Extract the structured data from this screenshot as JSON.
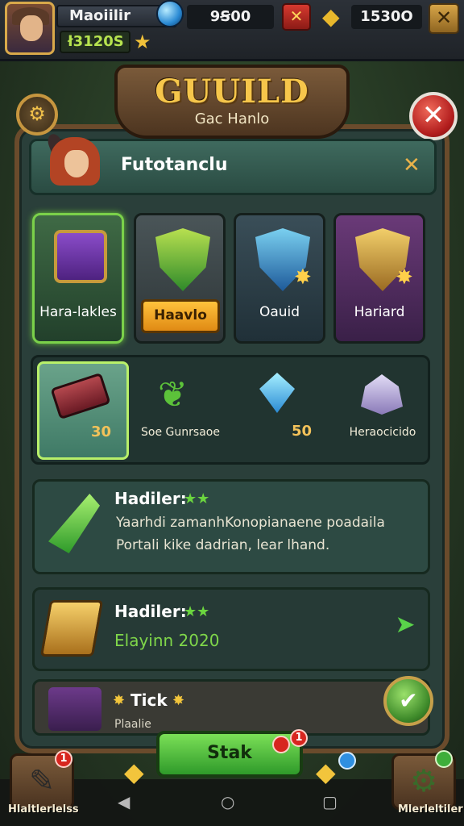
{
  "hud": {
    "player_name": "Maoiilir",
    "gold": "ł3120S",
    "resource_1": "9Ꞩ00",
    "resource_2": "1530O",
    "close_icon": "x-icon"
  },
  "banner": {
    "title": "GUUILD",
    "subtitle": "Gac Hanlo"
  },
  "header": {
    "title": "Futotanclu",
    "close_label": "✕"
  },
  "categories": [
    {
      "label": "Hara-lakles",
      "icon": "purple-chest-icon",
      "selected": true
    },
    {
      "label": "Haavlo",
      "icon": "green-shield-icon",
      "button": true
    },
    {
      "label": "Oauid",
      "icon": "blue-sword-shield-icon"
    },
    {
      "label": "Hariard",
      "icon": "golden-crest-icon"
    }
  ],
  "items": [
    {
      "value": "30",
      "icon": "scroll-icon",
      "selected": true
    },
    {
      "label": "Soe Gunrsaoe",
      "icon": "herb-leaf-icon"
    },
    {
      "value": "50",
      "icon": "crystal-sword-icon"
    },
    {
      "label": "Heraocicido",
      "icon": "gem-pile-icon"
    }
  ],
  "quests": [
    {
      "title": "Hadiler:",
      "stars": "★★",
      "line1": "Yaarhdi zamanhKonopianaene poadaila",
      "line2": "Portali kike dadrian,  lear lhand.",
      "icon": "green-leaf-icon"
    },
    {
      "title": "Hadiler:",
      "stars": "★★",
      "subtitle": "Elayinn 2020",
      "icon": "gold-card-icon"
    },
    {
      "title": "Tick",
      "stars_left": "✸",
      "stars_right": "✸",
      "subtitle": "Plaalie",
      "icon": "blue-blade-icon"
    }
  ],
  "start_button": {
    "label": "Stak",
    "badge": "1"
  },
  "nav": {
    "left_label": "Hlaltlerlelss",
    "right_label": "Mlerleltiler",
    "left_badge": "1"
  },
  "colors": {
    "accent_gold": "#f6c64b",
    "accent_green": "#6bd63f",
    "panel_bg": "#2a3f3a",
    "frame_brown": "#6a4b2c"
  }
}
